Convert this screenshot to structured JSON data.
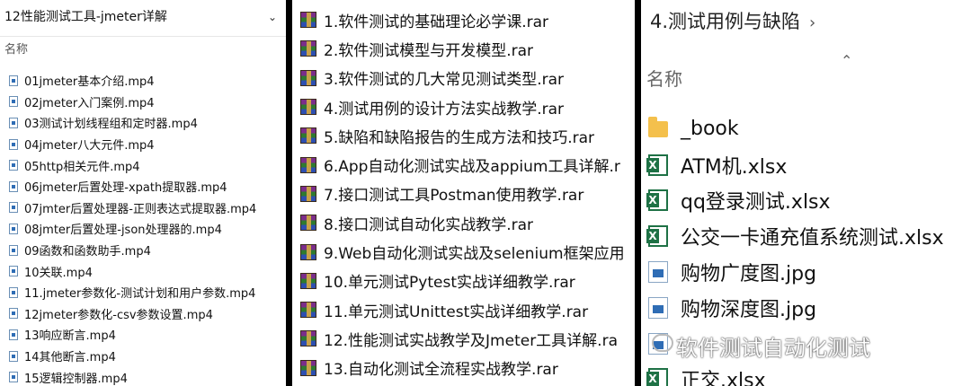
{
  "panel1": {
    "title": "12性能测试工具-jmeter详解",
    "column_name": "名称",
    "files": [
      "01jmeter基本介绍.mp4",
      "02jmeter入门案例.mp4",
      "03测试计划线程组和定时器.mp4",
      "04jmeter八大元件.mp4",
      "05http相关元件.mp4",
      "06jmeter后置处理-xpath提取器.mp4",
      "07jmter后置处理器-正则表达式提取器.mp4",
      "08jmter后置处理-json处理器的.mp4",
      "09函数和函数助手.mp4",
      "10关联.mp4",
      "11.jmeter参数化-测试计划和用户参数.mp4",
      "12jmeter参数化-csv参数设置.mp4",
      "13响应断言.mp4",
      "14其他断言.mp4",
      "15逻辑控制器.mp4"
    ]
  },
  "panel2": {
    "files": [
      "1.软件测试的基础理论必学课.rar",
      "2.软件测试模型与开发模型.rar",
      "3.软件测试的几大常见测试类型.rar",
      "4.测试用例的设计方法实战教学.rar",
      "5.缺陷和缺陷报告的生成方法和技巧.rar",
      "6.App自动化测试实战及appium工具详解.r",
      "7.接口测试工具Postman使用教学.rar",
      "8.接口测试自动化实战教学.rar",
      "9.Web自动化测试实战及selenium框架应用",
      "10.单元测试Pytest实战详细教学.rar",
      "11.单元测试Unittest实战详细教学.rar",
      "12.性能测试实战教学及Jmeter工具详解.ra",
      "13.自动化测试全流程实战教学.rar"
    ]
  },
  "panel3": {
    "breadcrumb": "4.测试用例与缺陷",
    "column_name": "名称",
    "files": [
      {
        "name": "_book",
        "icon": "folder-icon"
      },
      {
        "name": "ATM机.xlsx",
        "icon": "xlsx-icon"
      },
      {
        "name": "qq登录测试.xlsx",
        "icon": "xlsx-icon"
      },
      {
        "name": "公交一卡通充值系统测试.xlsx",
        "icon": "xlsx-icon"
      },
      {
        "name": "购物广度图.jpg",
        "icon": "jpg-icon"
      },
      {
        "name": "购物深度图.jpg",
        "icon": "jpg-icon"
      },
      {
        "name": "",
        "icon": "jpg-icon"
      },
      {
        "name": "正交.xlsx",
        "icon": "xlsx-icon"
      }
    ],
    "watermark": "软件测试自动化测试"
  }
}
